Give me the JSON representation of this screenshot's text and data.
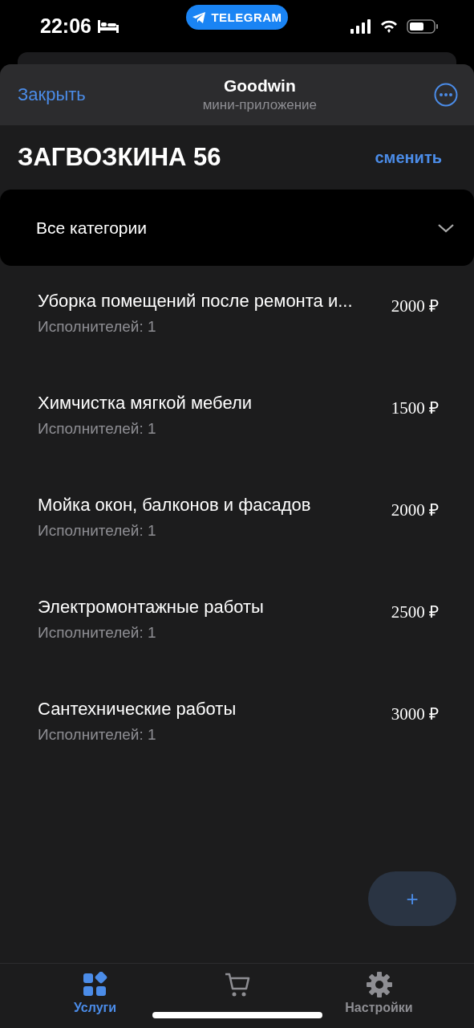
{
  "status_bar": {
    "time": "22:06",
    "pill": "TELEGRAM"
  },
  "header": {
    "close": "Закрыть",
    "title": "Goodwin",
    "subtitle": "мини-приложение"
  },
  "address": {
    "title": "ЗАГВОЗКИНА 56",
    "action": "сменить"
  },
  "category_select": {
    "value": "Все категории"
  },
  "services": [
    {
      "name": "Уборка помещений после ремонта и...",
      "performers": "Исполнителей: 1",
      "price": "2000 ₽"
    },
    {
      "name": "Химчистка мягкой мебели",
      "performers": "Исполнителей: 1",
      "price": "1500 ₽"
    },
    {
      "name": "Мойка окон, балконов и фасадов",
      "performers": "Исполнителей: 1",
      "price": "2000 ₽"
    },
    {
      "name": "Электромонтажные работы",
      "performers": "Исполнителей: 1",
      "price": "2500 ₽"
    },
    {
      "name": "Сантехнические работы",
      "performers": "Исполнителей: 1",
      "price": "3000 ₽"
    }
  ],
  "add_button": "+",
  "tabs": [
    {
      "kind": "services",
      "label": "Услуги",
      "selected": true
    },
    {
      "kind": "cart",
      "selected": false
    },
    {
      "kind": "settings",
      "label": "Настройки",
      "selected": false
    }
  ]
}
